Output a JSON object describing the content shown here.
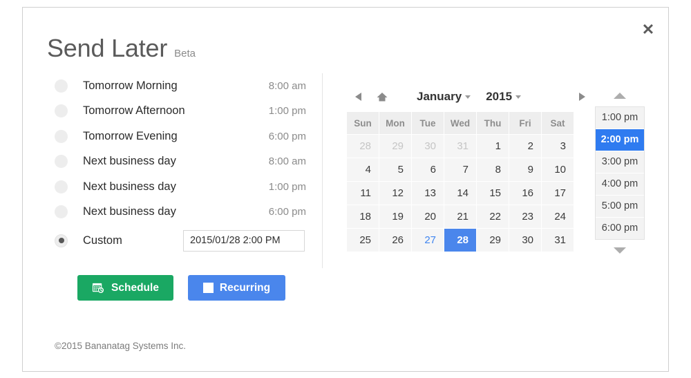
{
  "dialog": {
    "title": "Send Later",
    "badge": "Beta",
    "close_icon": "close-icon",
    "copyright": "©2015 Bananatag Systems Inc."
  },
  "options": {
    "items": [
      {
        "label": "Tomorrow Morning",
        "time": "8:00 am",
        "selected": false
      },
      {
        "label": "Tomorrow Afternoon",
        "time": "1:00 pm",
        "selected": false
      },
      {
        "label": "Tomorrow Evening",
        "time": "6:00 pm",
        "selected": false
      },
      {
        "label": "Next business day",
        "time": "8:00 am",
        "selected": false
      },
      {
        "label": "Next business day",
        "time": "1:00 pm",
        "selected": false
      },
      {
        "label": "Next business day",
        "time": "6:00 pm",
        "selected": false
      }
    ],
    "custom": {
      "label": "Custom",
      "selected": true,
      "input_value": "2015/01/28 2:00 PM",
      "input_placeholder": "YYYY/MM/DD h:mm A"
    }
  },
  "buttons": {
    "schedule": {
      "label": "Schedule",
      "icon": "calendar-clock-icon",
      "color": "#1aa863"
    },
    "recurring": {
      "label": "Recurring",
      "icon": "checkbox-square-icon",
      "color": "#4a86ec"
    }
  },
  "calendar": {
    "prev_icon": "prev-arrow-icon",
    "home_icon": "home-icon",
    "next_icon": "next-arrow-icon",
    "month": "January",
    "year": "2015",
    "weekdays": [
      "Sun",
      "Mon",
      "Tue",
      "Wed",
      "Thu",
      "Fri",
      "Sat"
    ],
    "weeks": [
      [
        {
          "day": "28",
          "state": "other"
        },
        {
          "day": "29",
          "state": "other"
        },
        {
          "day": "30",
          "state": "other"
        },
        {
          "day": "31",
          "state": "other"
        },
        {
          "day": "1",
          "state": "normal"
        },
        {
          "day": "2",
          "state": "normal"
        },
        {
          "day": "3",
          "state": "normal"
        }
      ],
      [
        {
          "day": "4",
          "state": "normal"
        },
        {
          "day": "5",
          "state": "normal"
        },
        {
          "day": "6",
          "state": "normal"
        },
        {
          "day": "7",
          "state": "normal"
        },
        {
          "day": "8",
          "state": "normal"
        },
        {
          "day": "9",
          "state": "normal"
        },
        {
          "day": "10",
          "state": "normal"
        }
      ],
      [
        {
          "day": "11",
          "state": "normal"
        },
        {
          "day": "12",
          "state": "normal"
        },
        {
          "day": "13",
          "state": "normal"
        },
        {
          "day": "14",
          "state": "normal"
        },
        {
          "day": "15",
          "state": "normal"
        },
        {
          "day": "16",
          "state": "normal"
        },
        {
          "day": "17",
          "state": "normal"
        }
      ],
      [
        {
          "day": "18",
          "state": "normal"
        },
        {
          "day": "19",
          "state": "normal"
        },
        {
          "day": "20",
          "state": "normal"
        },
        {
          "day": "21",
          "state": "normal"
        },
        {
          "day": "22",
          "state": "normal"
        },
        {
          "day": "23",
          "state": "normal"
        },
        {
          "day": "24",
          "state": "normal"
        }
      ],
      [
        {
          "day": "25",
          "state": "normal"
        },
        {
          "day": "26",
          "state": "normal"
        },
        {
          "day": "27",
          "state": "today"
        },
        {
          "day": "28",
          "state": "selected"
        },
        {
          "day": "29",
          "state": "normal"
        },
        {
          "day": "30",
          "state": "normal"
        },
        {
          "day": "31",
          "state": "normal"
        }
      ]
    ],
    "selected_day": "28",
    "today_day": "27",
    "accent_color": "#4a86ec"
  },
  "time_picker": {
    "scroll_up_icon": "triangle-up-icon",
    "scroll_down_icon": "triangle-down-icon",
    "times": [
      "1:00 pm",
      "2:00 pm",
      "3:00 pm",
      "4:00 pm",
      "5:00 pm",
      "6:00 pm"
    ],
    "selected_time": "2:00 pm"
  }
}
